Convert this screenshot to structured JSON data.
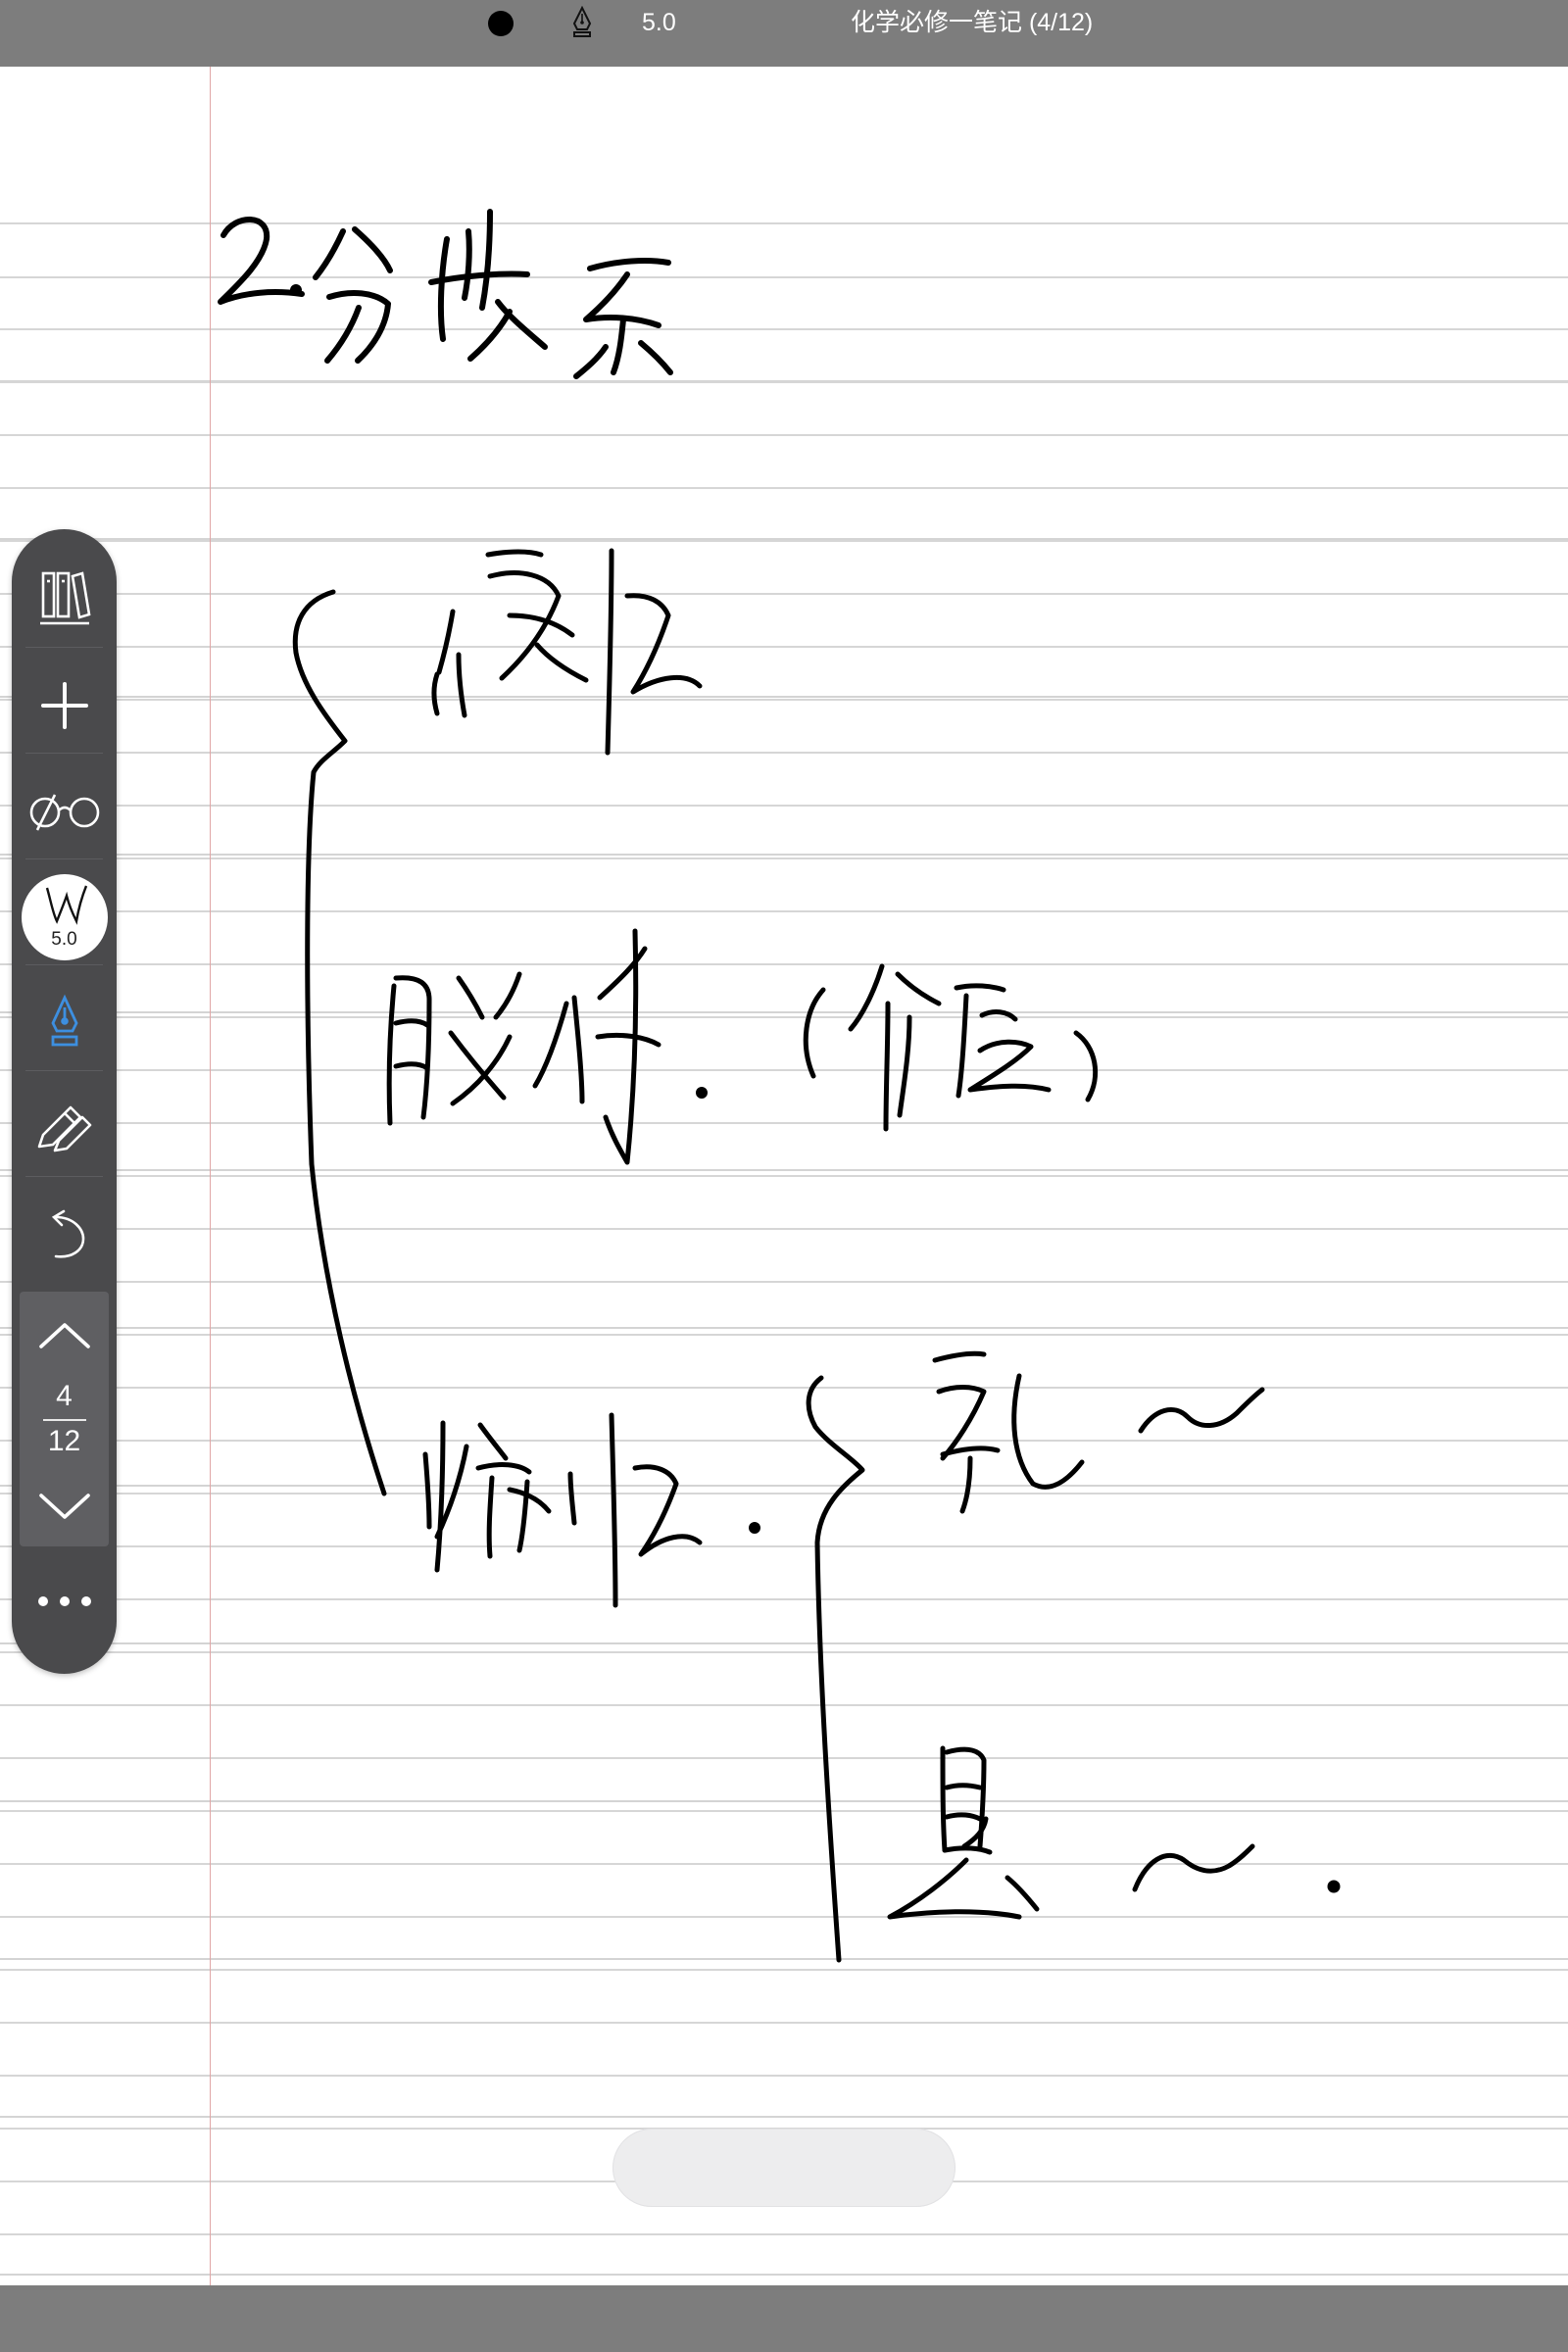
{
  "status_bar": {
    "pen_size": "5.0",
    "document_title": "化学必修一笔记 (4/12)"
  },
  "toolbar": {
    "pen_badge_size": "5.0",
    "current_page": "4",
    "total_pages": "12"
  },
  "colors": {
    "bar_gray": "#7d7d7d",
    "toolbar_bg": "#4a4a4c",
    "ink": "#000000",
    "selected_tool": "#3d8fe0",
    "margin_line": "#e0a6a6",
    "rule_line": "#d4d4d4"
  },
  "icons": [
    "ink-color-dot-icon",
    "fountain-pen-icon",
    "library-icon",
    "add-icon",
    "glasses-icon",
    "pen-width-icon",
    "fountain-pen-icon",
    "pencil-icon",
    "undo-icon",
    "chevron-up-icon",
    "chevron-down-icon",
    "more-icon"
  ]
}
